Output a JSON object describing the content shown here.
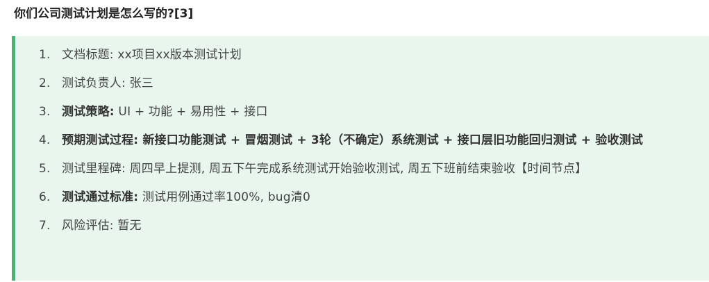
{
  "heading": "你们公司测试计划是怎么写的?[3]",
  "items": [
    {
      "num": "1.",
      "label": "文档标题:",
      "value": "xx项目xx版本测试计划"
    },
    {
      "num": "2.",
      "label": "测试负责人:",
      "value": "张三"
    },
    {
      "num": "3.",
      "label": "测试策略:",
      "value": "UI + 功能 + 易用性 + 接口"
    },
    {
      "num": "4.",
      "label": "预期测试过程:",
      "value": "新接口功能测试 + 冒烟测试 + 3轮（不确定）系统测试 + 接口层旧功能回归测试 + 验收测试"
    },
    {
      "num": "5.",
      "label": "测试里程碑:",
      "value": "周四早上提测, 周五下午完成系统测试开始验收测试, 周五下班前结束验收【时间节点】"
    },
    {
      "num": "6.",
      "label": "测试通过标准:",
      "value": "测试用例通过率100%, bug清0"
    },
    {
      "num": "7.",
      "label": "风险评估:",
      "value": "暂无"
    }
  ],
  "colors": {
    "quote_background": "#e8f6ee",
    "quote_border": "#3fb96f"
  }
}
